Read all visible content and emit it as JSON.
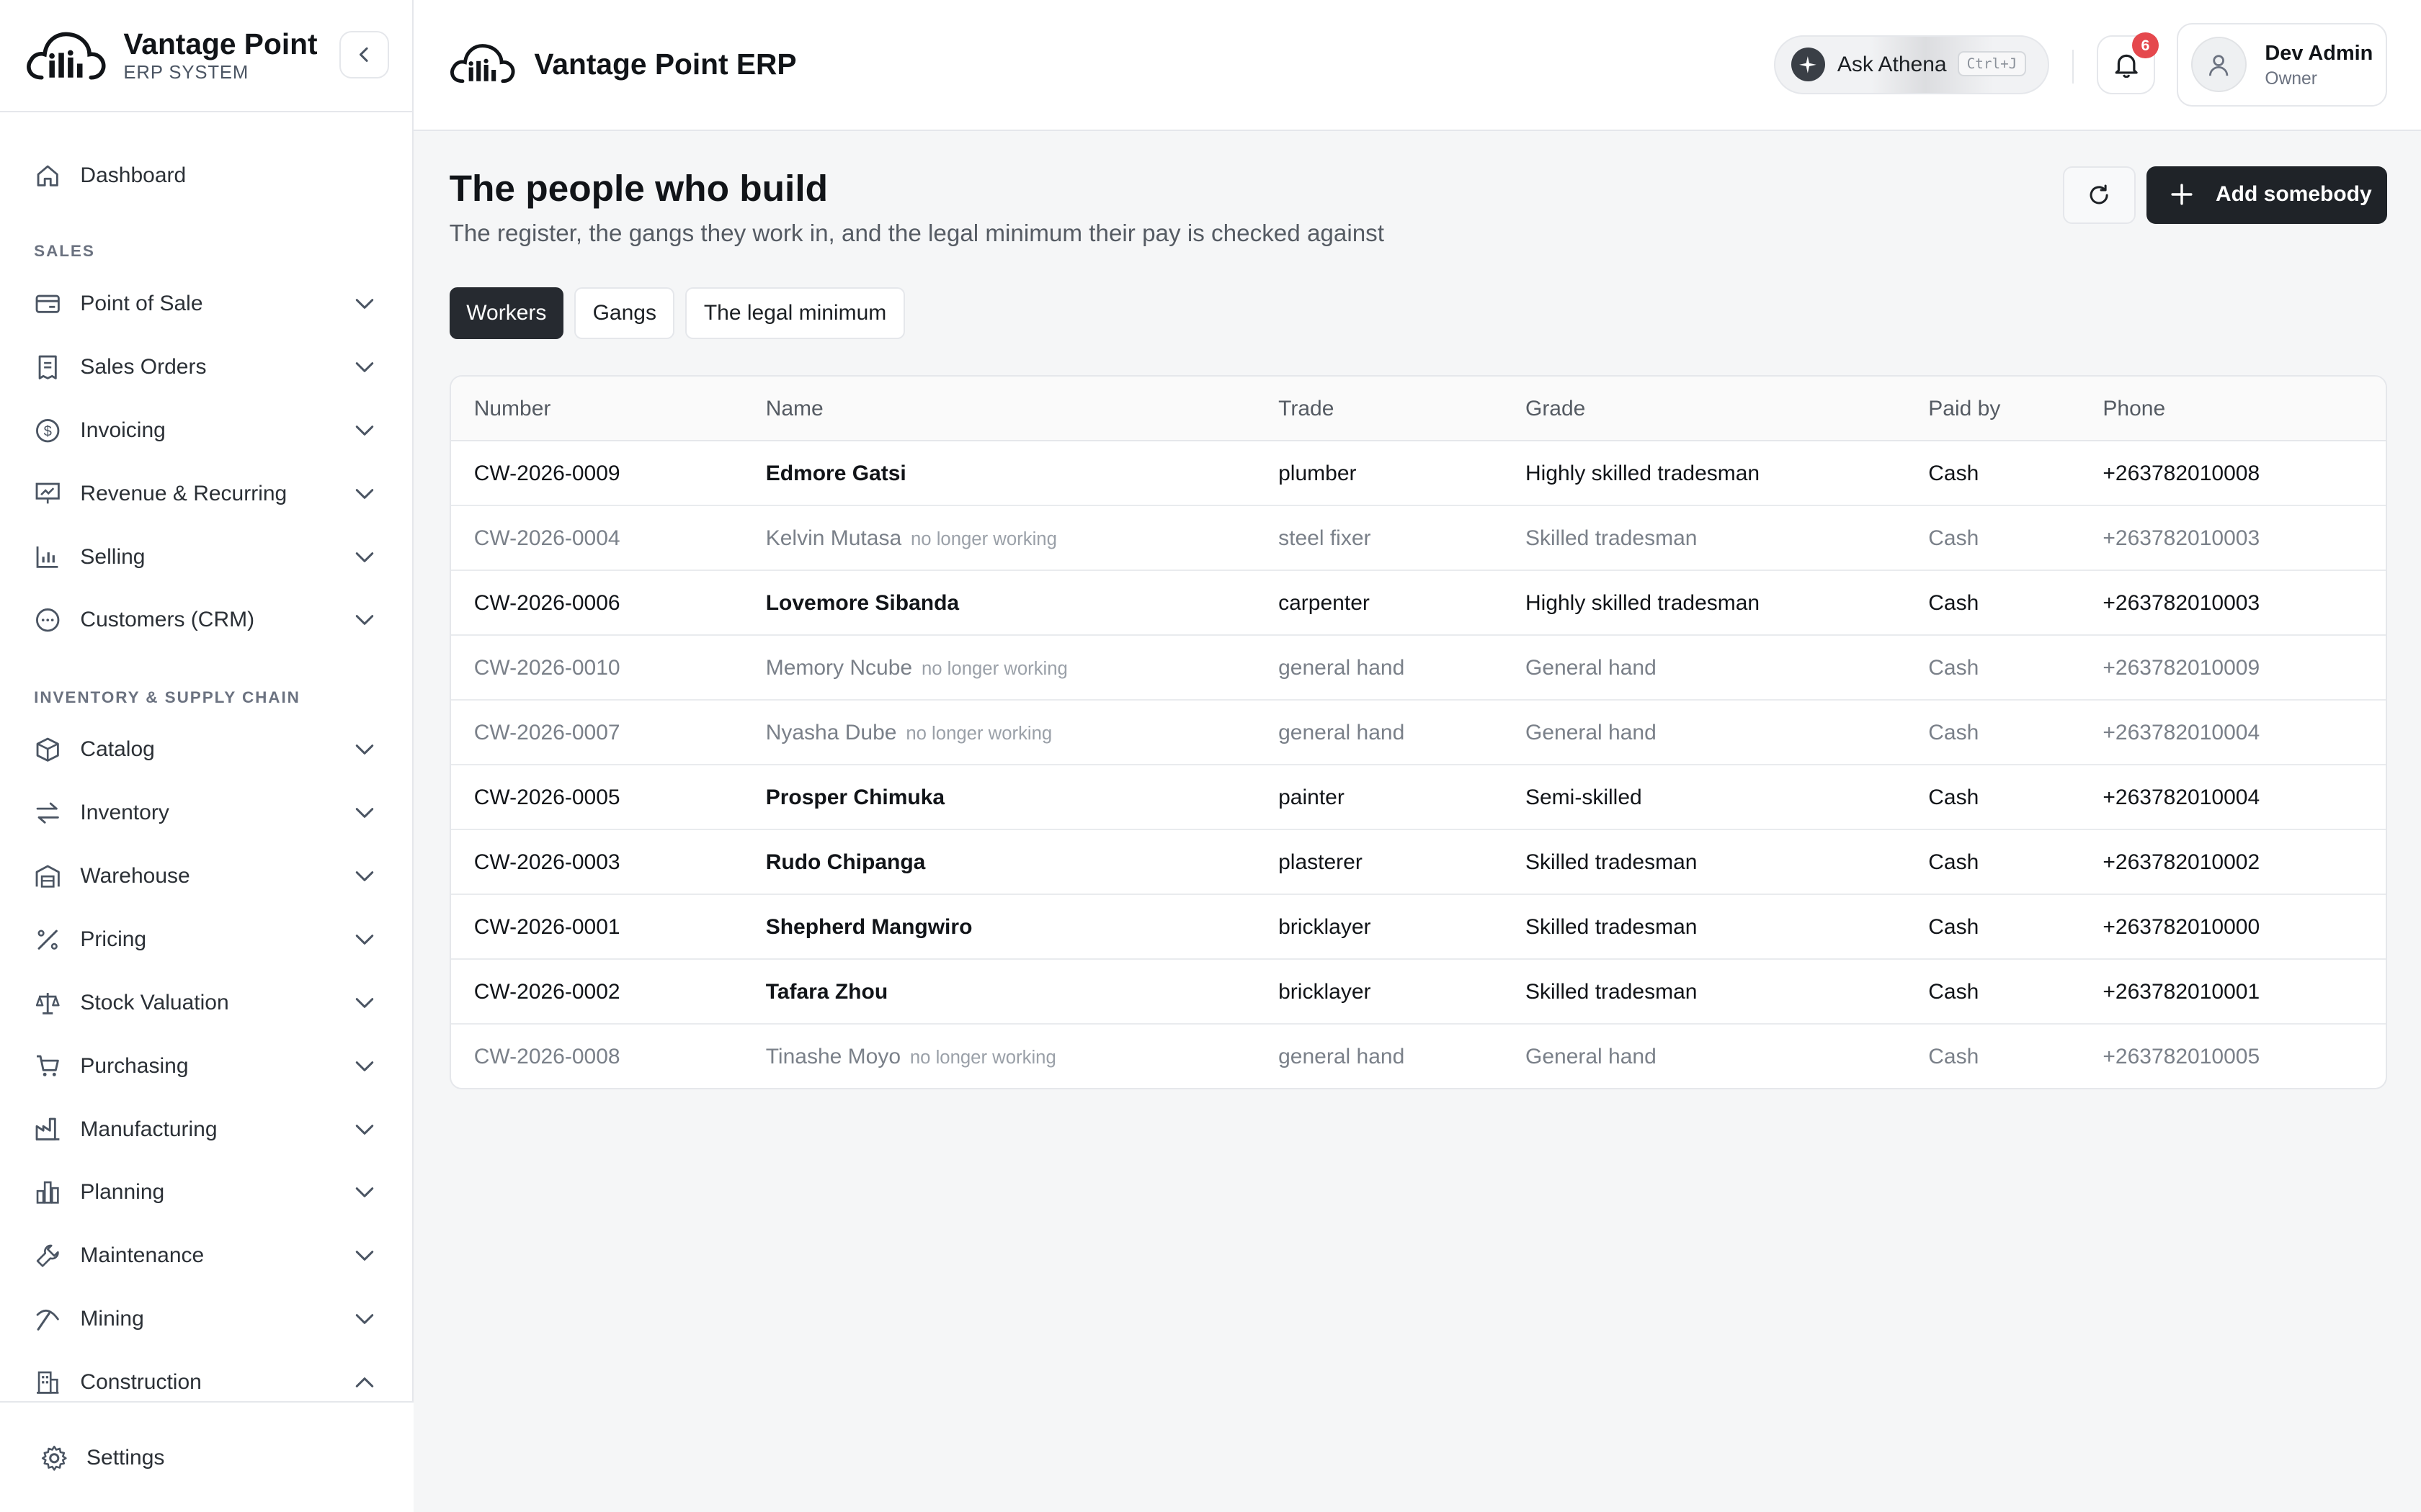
{
  "brand": {
    "title": "Vantage Point",
    "subtitle": "ERP SYSTEM"
  },
  "sidebar": {
    "dashboard": "Dashboard",
    "sections": {
      "sales": "SALES",
      "inventory": "INVENTORY & SUPPLY CHAIN"
    },
    "items": [
      {
        "label": "Point of Sale"
      },
      {
        "label": "Sales Orders"
      },
      {
        "label": "Invoicing"
      },
      {
        "label": "Revenue & Recurring"
      },
      {
        "label": "Selling"
      },
      {
        "label": "Customers (CRM)"
      },
      {
        "label": "Catalog"
      },
      {
        "label": "Inventory"
      },
      {
        "label": "Warehouse"
      },
      {
        "label": "Pricing"
      },
      {
        "label": "Stock Valuation"
      },
      {
        "label": "Purchasing"
      },
      {
        "label": "Manufacturing"
      },
      {
        "label": "Planning"
      },
      {
        "label": "Maintenance"
      },
      {
        "label": "Mining"
      },
      {
        "label": "Construction"
      }
    ],
    "settings": "Settings"
  },
  "header": {
    "title": "Vantage Point ERP",
    "ask": "Ask Athena",
    "ask_shortcut": "Ctrl+J",
    "notifications": "6",
    "user_name": "Dev Admin",
    "user_role": "Owner"
  },
  "page": {
    "title": "The people who build",
    "subtitle": "The register, the gangs they work in, and the legal minimum their pay is checked against",
    "add_button": "Add somebody"
  },
  "tabs": [
    "Workers",
    "Gangs",
    "The legal minimum"
  ],
  "table": {
    "columns": [
      "Number",
      "Name",
      "Trade",
      "Grade",
      "Paid by",
      "Phone"
    ],
    "rows": [
      {
        "number": "CW-2026-0009",
        "name": "Edmore Gatsi",
        "status": "",
        "trade": "plumber",
        "grade": "Highly skilled tradesman",
        "paid_by": "Cash",
        "phone": "+263782010008"
      },
      {
        "number": "CW-2026-0004",
        "name": "Kelvin Mutasa",
        "status": "no longer working",
        "trade": "steel fixer",
        "grade": "Skilled tradesman",
        "paid_by": "Cash",
        "phone": "+263782010003"
      },
      {
        "number": "CW-2026-0006",
        "name": "Lovemore Sibanda",
        "status": "",
        "trade": "carpenter",
        "grade": "Highly skilled tradesman",
        "paid_by": "Cash",
        "phone": "+263782010003"
      },
      {
        "number": "CW-2026-0010",
        "name": "Memory Ncube",
        "status": "no longer working",
        "trade": "general hand",
        "grade": "General hand",
        "paid_by": "Cash",
        "phone": "+263782010009"
      },
      {
        "number": "CW-2026-0007",
        "name": "Nyasha Dube",
        "status": "no longer working",
        "trade": "general hand",
        "grade": "General hand",
        "paid_by": "Cash",
        "phone": "+263782010004"
      },
      {
        "number": "CW-2026-0005",
        "name": "Prosper Chimuka",
        "status": "",
        "trade": "painter",
        "grade": "Semi-skilled",
        "paid_by": "Cash",
        "phone": "+263782010004"
      },
      {
        "number": "CW-2026-0003",
        "name": "Rudo Chipanga",
        "status": "",
        "trade": "plasterer",
        "grade": "Skilled tradesman",
        "paid_by": "Cash",
        "phone": "+263782010002"
      },
      {
        "number": "CW-2026-0001",
        "name": "Shepherd Mangwiro",
        "status": "",
        "trade": "bricklayer",
        "grade": "Skilled tradesman",
        "paid_by": "Cash",
        "phone": "+263782010000"
      },
      {
        "number": "CW-2026-0002",
        "name": "Tafara Zhou",
        "status": "",
        "trade": "bricklayer",
        "grade": "Skilled tradesman",
        "paid_by": "Cash",
        "phone": "+263782010001"
      },
      {
        "number": "CW-2026-0008",
        "name": "Tinashe Moyo",
        "status": "no longer working",
        "trade": "general hand",
        "grade": "General hand",
        "paid_by": "Cash",
        "phone": "+263782010005"
      }
    ]
  },
  "colors": {
    "primary": "#1f2328",
    "badge": "#e5484d",
    "inactive_text": "#7a8089"
  }
}
